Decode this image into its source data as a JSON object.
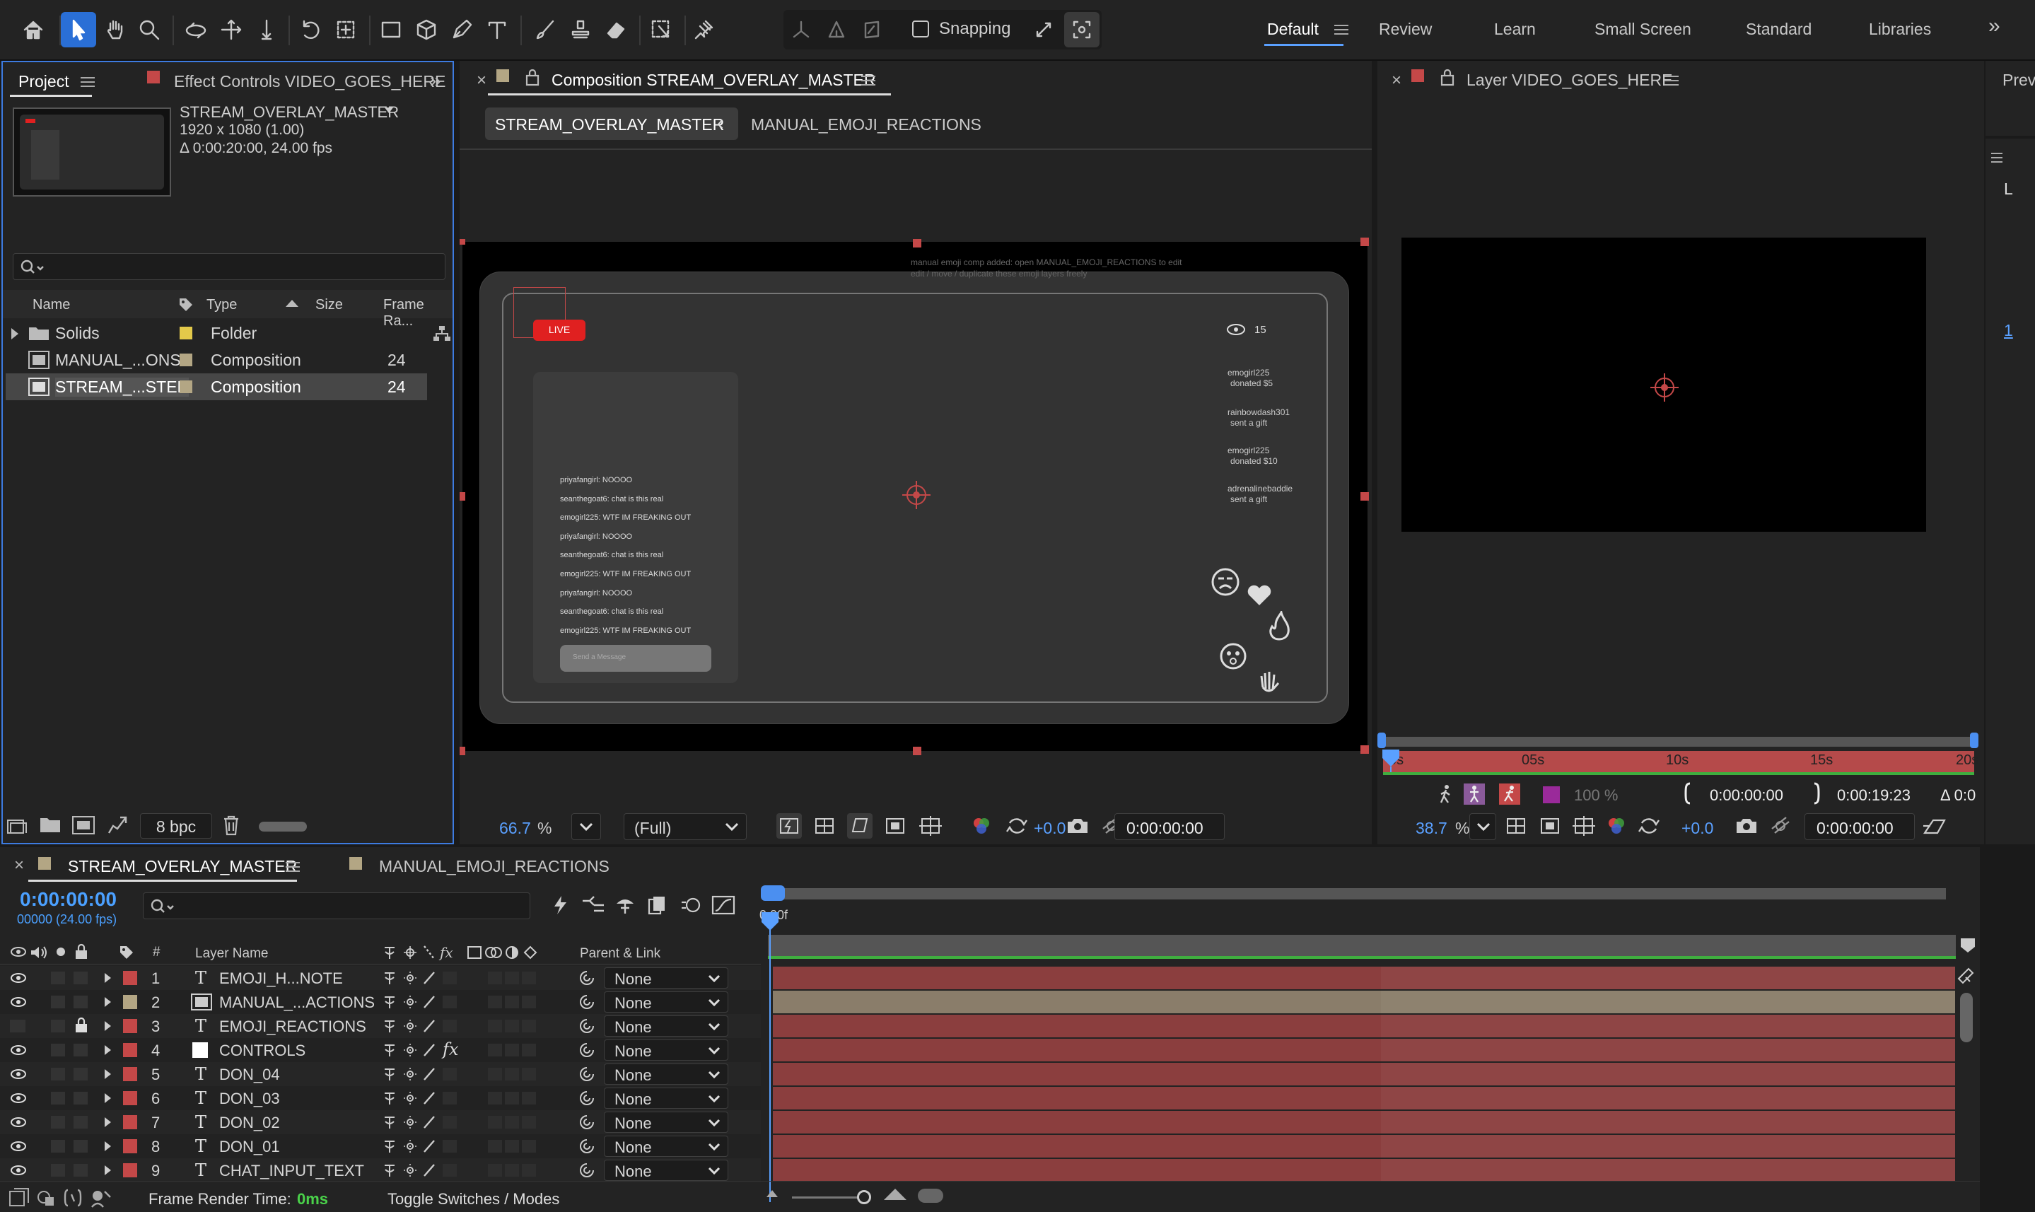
{
  "toolbar": {
    "snapping_label": "Snapping"
  },
  "workspaces": {
    "items": [
      "Default",
      "Review",
      "Learn",
      "Small Screen",
      "Standard",
      "Libraries"
    ],
    "overflow": "»"
  },
  "project_panel": {
    "tab_project": "Project",
    "tab_effect_controls": "Effect Controls VIDEO_GOES_HERE",
    "comp_name": "STREAM_OVERLAY_MASTER",
    "comp_dims": "1920 x 1080 (1.00)",
    "comp_duration": "Δ 0:00:20:00, 24.00 fps",
    "search_placeholder": "",
    "columns": {
      "name": "Name",
      "type": "Type",
      "size": "Size",
      "frame_rate": "Frame Ra..."
    },
    "items": [
      {
        "name": "Solids",
        "type": "Folder",
        "fps": "",
        "color": "#e3c94a"
      },
      {
        "name": "MANUAL_...ONS",
        "type": "Composition",
        "fps": "24",
        "color": "#b3a684"
      },
      {
        "name": "STREAM_...STER",
        "type": "Composition",
        "fps": "24",
        "color": "#b3a684"
      }
    ],
    "bpc": "8 bpc"
  },
  "composition_panel": {
    "title": "Composition STREAM_OVERLAY_MASTER",
    "breadcrumb_active": "STREAM_OVERLAY_MASTER",
    "breadcrumb_next": "MANUAL_EMOJI_REACTIONS",
    "zoom_value": "66.7",
    "zoom_unit": "%",
    "resolution": "(Full)",
    "exposure": "+0.0",
    "timecode": "0:00:00:00"
  },
  "overlay": {
    "note_line1": "manual emoji comp added: open MANUAL_EMOJI_REACTIONS to edit",
    "note_line2": "edit / move / duplicate these emoji layers freely",
    "live_label": "LIVE",
    "viewer_count": "15",
    "donations": [
      {
        "line1": "emogirl225",
        "line2": "donated $5"
      },
      {
        "line1": "rainbowdash301",
        "line2": "sent a gift"
      },
      {
        "line1": "emogirl225",
        "line2": "donated $10"
      },
      {
        "line1": "adrenalinebaddie",
        "line2": "sent a gift"
      }
    ],
    "chat": [
      "priyafangirl: NOOOO",
      "seanthegoat6: chat is this real",
      "emogirl225: WTF IM FREAKING OUT",
      "priyafangirl: NOOOO",
      "seanthegoat6: chat is this real",
      "emogirl225: WTF IM FREAKING OUT",
      "priyafangirl: NOOOO",
      "seanthegoat6: chat is this real",
      "emogirl225: WTF IM FREAKING OUT"
    ],
    "send_placeholder": "Send a Message"
  },
  "layer_panel": {
    "title": "Layer VIDEO_GOES_HERE",
    "ruler": [
      "0s",
      "05s",
      "10s",
      "15s",
      "20s"
    ],
    "opacity": "100 %",
    "in_time": "0:00:00:00",
    "out_time": "0:00:19:23",
    "delta": "Δ 0:0",
    "zoom_value": "38.7",
    "zoom_unit": "%",
    "exposure": "+0.0",
    "timecode": "0:00:00:00",
    "right_tab": "Previ",
    "right_letter": "L",
    "right_num": "1"
  },
  "timeline": {
    "tab_active": "STREAM_OVERLAY_MASTER",
    "tab_other": "MANUAL_EMOJI_REACTIONS",
    "timecode": "0:00:00:00",
    "frames": "00000 (24.00 fps)",
    "ruler_start": "0:00f",
    "col_num": "#",
    "col_layer_name": "Layer Name",
    "col_parent": "Parent & Link",
    "layers": [
      {
        "num": "1",
        "name": "EMOJI_H...NOTE",
        "kind": "T",
        "color": "#c44848",
        "parent": "None",
        "fx": false,
        "lock": false,
        "eye": true
      },
      {
        "num": "2",
        "name": "MANUAL_...ACTIONS",
        "kind": "comp",
        "color": "#b3a684",
        "parent": "None",
        "fx": false,
        "lock": false,
        "eye": true
      },
      {
        "num": "3",
        "name": "EMOJI_REACTIONS",
        "kind": "T",
        "color": "#c44848",
        "parent": "None",
        "fx": false,
        "lock": true,
        "eye": false
      },
      {
        "num": "4",
        "name": "CONTROLS",
        "kind": "solid",
        "color": "#c44848",
        "parent": "None",
        "fx": true,
        "lock": false,
        "eye": true
      },
      {
        "num": "5",
        "name": "DON_04",
        "kind": "T",
        "color": "#c44848",
        "parent": "None",
        "fx": false,
        "lock": false,
        "eye": true
      },
      {
        "num": "6",
        "name": "DON_03",
        "kind": "T",
        "color": "#c44848",
        "parent": "None",
        "fx": false,
        "lock": false,
        "eye": true
      },
      {
        "num": "7",
        "name": "DON_02",
        "kind": "T",
        "color": "#c44848",
        "parent": "None",
        "fx": false,
        "lock": false,
        "eye": true
      },
      {
        "num": "8",
        "name": "DON_01",
        "kind": "T",
        "color": "#c44848",
        "parent": "None",
        "fx": false,
        "lock": false,
        "eye": true
      },
      {
        "num": "9",
        "name": "CHAT_INPUT_TEXT",
        "kind": "T",
        "color": "#c44848",
        "parent": "None",
        "fx": false,
        "lock": false,
        "eye": true
      }
    ],
    "render_time_label": "Frame Render Time:",
    "render_time_value": "0ms",
    "toggle_label": "Toggle Switches / Modes"
  },
  "colors": {
    "accent_blue": "#2a6fd6",
    "timecode_blue": "#4ba0ff",
    "layer_red": "#8b3e3e",
    "comp_tan": "#8a7d6a",
    "live_red": "#e02020"
  }
}
